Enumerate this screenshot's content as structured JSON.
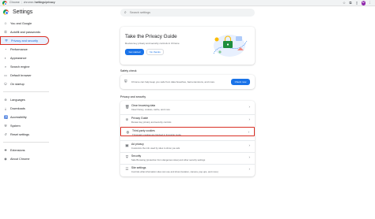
{
  "browser": {
    "site_label": "Chrome",
    "url_host": "chrome://",
    "url_path": "settings/privacy",
    "profile_initial": "U"
  },
  "header": {
    "title": "Settings",
    "search_placeholder": "Search settings"
  },
  "sidebar": {
    "items": [
      {
        "label": "You and Google",
        "icon": "person-icon"
      },
      {
        "label": "Autofill and passwords",
        "icon": "key-icon"
      },
      {
        "label": "Privacy and security",
        "icon": "shield-icon",
        "active": true
      },
      {
        "label": "Performance",
        "icon": "speed-icon"
      },
      {
        "label": "Appearance",
        "icon": "palette-icon"
      },
      {
        "label": "Search engine",
        "icon": "search-icon"
      },
      {
        "label": "Default browser",
        "icon": "browser-icon"
      },
      {
        "label": "On startup",
        "icon": "power-icon"
      },
      {
        "label": "Languages",
        "icon": "globe-icon"
      },
      {
        "label": "Downloads",
        "icon": "download-icon"
      },
      {
        "label": "Accessibility",
        "icon": "accessibility-icon"
      },
      {
        "label": "System",
        "icon": "wrench-icon"
      },
      {
        "label": "Reset settings",
        "icon": "reset-icon"
      },
      {
        "label": "Extensions",
        "icon": "puzzle-icon"
      },
      {
        "label": "About Chrome",
        "icon": "chrome-icon"
      }
    ]
  },
  "privacy_guide": {
    "title": "Take the Privacy Guide",
    "description": "Review key privacy and security controls in Chrome",
    "primary_button": "Get started",
    "secondary_button": "No thanks"
  },
  "safety_check": {
    "label": "Safety check",
    "text": "Chrome can help keep you safe from data breaches, bad extensions, and more",
    "button": "Check now"
  },
  "privacy_section": {
    "label": "Privacy and security",
    "rows": [
      {
        "title": "Clear browsing data",
        "sub": "Clear history, cookies, cache, and more",
        "icon": "trash-icon"
      },
      {
        "title": "Privacy Guide",
        "sub": "Review key privacy and security controls",
        "icon": "compass-icon"
      },
      {
        "title": "Third-party cookies",
        "sub": "Third-party cookies are blocked in Incognito mode",
        "icon": "cookie-icon",
        "highlighted": true
      },
      {
        "title": "Ad privacy",
        "sub": "Customize the info used by sites to show you ads",
        "icon": "ad-icon"
      },
      {
        "title": "Security",
        "sub": "Safe Browsing (protection from dangerous sites) and other security settings",
        "icon": "shield-icon"
      },
      {
        "title": "Site settings",
        "sub": "Controls what information sites can use and show (location, camera, pop-ups, and more)",
        "icon": "sliders-icon"
      }
    ]
  },
  "colors": {
    "accent": "#1a73e8",
    "highlight_border": "#d93025",
    "active_bg": "#e8f0fe"
  }
}
